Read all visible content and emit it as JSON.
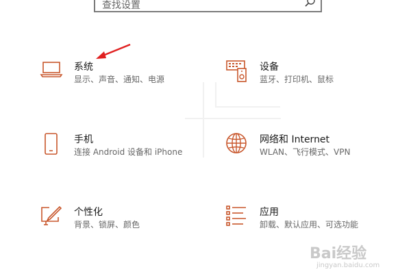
{
  "search": {
    "placeholder": "查找设置"
  },
  "tiles": [
    {
      "title": "系统",
      "desc": "显示、声音、通知、电源",
      "icon": "laptop-icon"
    },
    {
      "title": "设备",
      "desc": "蓝牙、打印机、鼠标",
      "icon": "devices-icon"
    },
    {
      "title": "手机",
      "desc": "连接 Android 设备和 iPhone",
      "icon": "phone-icon"
    },
    {
      "title": "网络和 Internet",
      "desc": "WLAN、飞行模式、VPN",
      "icon": "globe-icon"
    },
    {
      "title": "个性化",
      "desc": "背景、锁屏、颜色",
      "icon": "personalization-icon"
    },
    {
      "title": "应用",
      "desc": "卸载、默认应用、可选功能",
      "icon": "apps-icon"
    }
  ],
  "colors": {
    "accent": "#c8562b",
    "arrow": "#e02020"
  },
  "watermark": {
    "main": "Bai经验",
    "sub": "jingyan.baidu.com"
  }
}
